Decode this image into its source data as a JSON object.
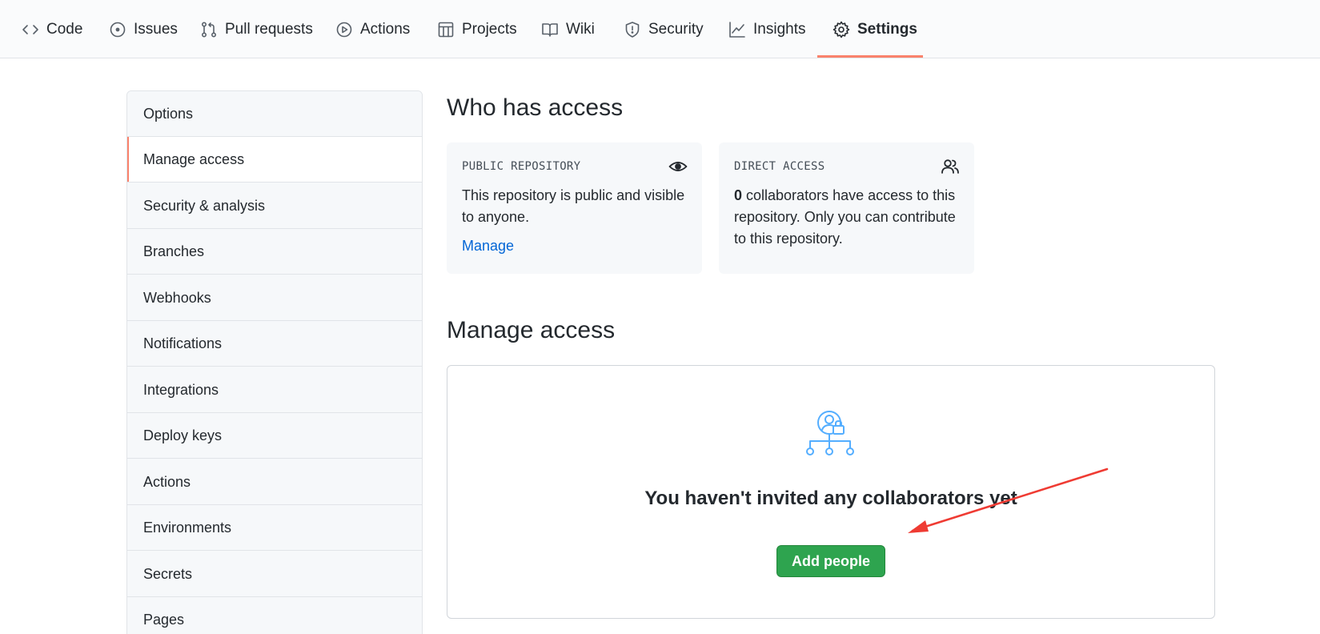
{
  "tabs": [
    {
      "label": "Code",
      "icon": "code-icon"
    },
    {
      "label": "Issues",
      "icon": "issue-icon"
    },
    {
      "label": "Pull requests",
      "icon": "pull-request-icon"
    },
    {
      "label": "Actions",
      "icon": "play-icon"
    },
    {
      "label": "Projects",
      "icon": "project-icon"
    },
    {
      "label": "Wiki",
      "icon": "book-icon"
    },
    {
      "label": "Security",
      "icon": "shield-icon"
    },
    {
      "label": "Insights",
      "icon": "graph-icon"
    },
    {
      "label": "Settings",
      "icon": "gear-icon",
      "selected": true
    }
  ],
  "sidebar": {
    "items": [
      {
        "label": "Options"
      },
      {
        "label": "Manage access",
        "active": true
      },
      {
        "label": "Security & analysis"
      },
      {
        "label": "Branches"
      },
      {
        "label": "Webhooks"
      },
      {
        "label": "Notifications"
      },
      {
        "label": "Integrations"
      },
      {
        "label": "Deploy keys"
      },
      {
        "label": "Actions"
      },
      {
        "label": "Environments"
      },
      {
        "label": "Secrets"
      },
      {
        "label": "Pages"
      }
    ]
  },
  "who_has_access": {
    "title": "Who has access",
    "public_card": {
      "label": "PUBLIC REPOSITORY",
      "icon": "eye-icon",
      "text": "This repository is public and visible to anyone.",
      "link": "Manage"
    },
    "direct_card": {
      "label": "DIRECT ACCESS",
      "icon": "people-icon",
      "count": "0",
      "text": " collaborators have access to this repository. Only you can contribute to this repository."
    }
  },
  "manage_access": {
    "title": "Manage access",
    "empty_icon": "person-lock-network-icon",
    "empty_title": "You haven't invited any collaborators yet",
    "add_button": "Add people"
  },
  "colors": {
    "accent": "#f9826c",
    "link": "#0366d6",
    "button": "#2ea44f",
    "annotation_arrow": "#ef3b33"
  }
}
